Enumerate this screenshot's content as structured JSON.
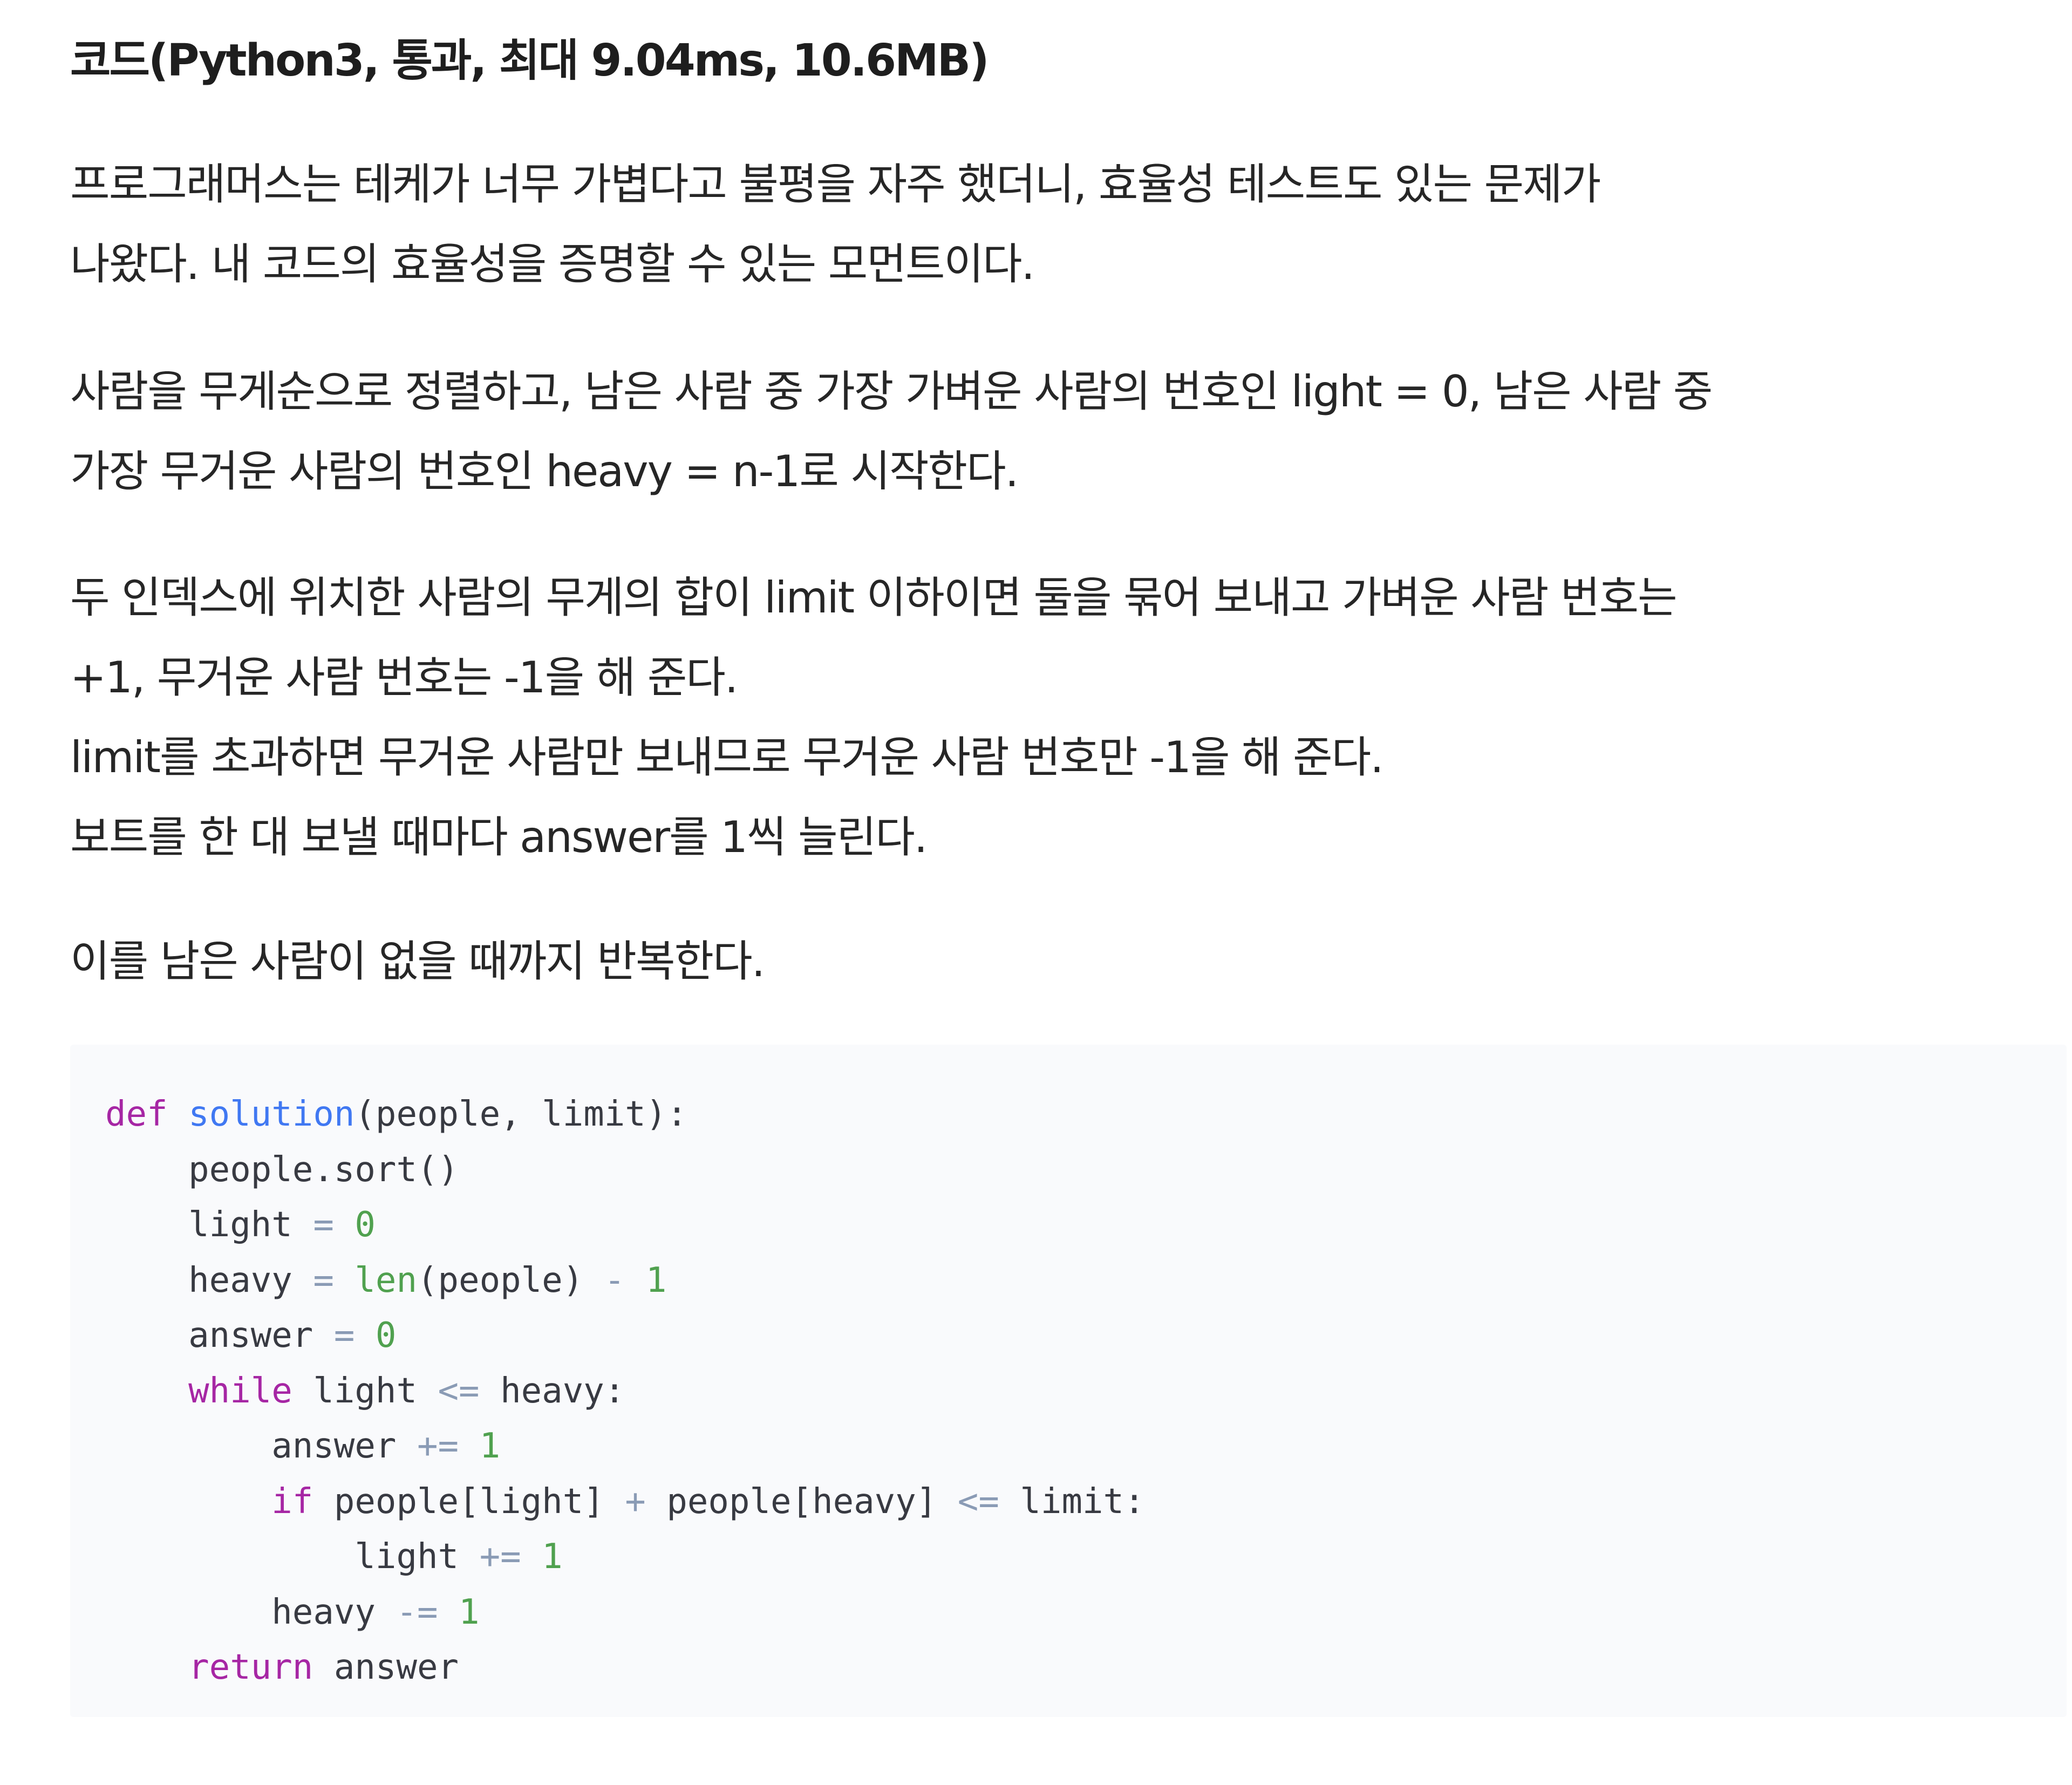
{
  "heading": "코드(Python3, 통과, 최대 9.04ms, 10.6MB)",
  "paragraphs": [
    {
      "lines": [
        "프로그래머스는 테케가 너무 가볍다고 불평을 자주 했더니, 효율성 테스트도 있는 문제가",
        "나왔다. 내 코드의 효율성을 증명할 수 있는 모먼트이다."
      ]
    },
    {
      "lines": [
        "사람을 무게순으로 정렬하고, 남은 사람 중 가장 가벼운 사람의 번호인 light = 0, 남은 사람 중",
        "가장 무거운 사람의 번호인 heavy = n-1로 시작한다."
      ]
    },
    {
      "lines": [
        "두 인덱스에 위치한 사람의 무게의 합이 limit 이하이면 둘을 묶어 보내고 가벼운 사람 번호는",
        "+1, 무거운 사람 번호는 -1을 해 준다.",
        "limit를 초과하면 무거운 사람만 보내므로 무거운 사람 번호만 -1을 해 준다.",
        "보트를 한 대 보낼 때마다 answer를 1씩 늘린다."
      ]
    },
    {
      "lines": [
        "이를 남은 사람이 없을 때까지 반복한다."
      ]
    }
  ],
  "code": {
    "language": "python",
    "lines": [
      [
        {
          "t": "kw",
          "v": "def"
        },
        {
          "t": "plain",
          "v": " "
        },
        {
          "t": "fn",
          "v": "solution"
        },
        {
          "t": "plain",
          "v": "(people, limit):"
        }
      ],
      [
        {
          "t": "plain",
          "v": "    people.sort()"
        }
      ],
      [
        {
          "t": "plain",
          "v": "    light "
        },
        {
          "t": "op",
          "v": "="
        },
        {
          "t": "plain",
          "v": " "
        },
        {
          "t": "num",
          "v": "0"
        }
      ],
      [
        {
          "t": "plain",
          "v": "    heavy "
        },
        {
          "t": "op",
          "v": "="
        },
        {
          "t": "plain",
          "v": " "
        },
        {
          "t": "builtin",
          "v": "len"
        },
        {
          "t": "plain",
          "v": "(people) "
        },
        {
          "t": "op",
          "v": "-"
        },
        {
          "t": "plain",
          "v": " "
        },
        {
          "t": "num",
          "v": "1"
        }
      ],
      [
        {
          "t": "plain",
          "v": "    answer "
        },
        {
          "t": "op",
          "v": "="
        },
        {
          "t": "plain",
          "v": " "
        },
        {
          "t": "num",
          "v": "0"
        }
      ],
      [
        {
          "t": "plain",
          "v": "    "
        },
        {
          "t": "kw",
          "v": "while"
        },
        {
          "t": "plain",
          "v": " light "
        },
        {
          "t": "op",
          "v": "<="
        },
        {
          "t": "plain",
          "v": " heavy:"
        }
      ],
      [
        {
          "t": "plain",
          "v": "        answer "
        },
        {
          "t": "op",
          "v": "+="
        },
        {
          "t": "plain",
          "v": " "
        },
        {
          "t": "num",
          "v": "1"
        }
      ],
      [
        {
          "t": "plain",
          "v": "        "
        },
        {
          "t": "kw",
          "v": "if"
        },
        {
          "t": "plain",
          "v": " people[light] "
        },
        {
          "t": "op",
          "v": "+"
        },
        {
          "t": "plain",
          "v": " people[heavy] "
        },
        {
          "t": "op",
          "v": "<="
        },
        {
          "t": "plain",
          "v": " limit:"
        }
      ],
      [
        {
          "t": "plain",
          "v": "            light "
        },
        {
          "t": "op",
          "v": "+="
        },
        {
          "t": "plain",
          "v": " "
        },
        {
          "t": "num",
          "v": "1"
        }
      ],
      [
        {
          "t": "plain",
          "v": "        heavy "
        },
        {
          "t": "op",
          "v": "-="
        },
        {
          "t": "plain",
          "v": " "
        },
        {
          "t": "num",
          "v": "1"
        }
      ],
      [
        {
          "t": "plain",
          "v": "    "
        },
        {
          "t": "kw",
          "v": "return"
        },
        {
          "t": "plain",
          "v": " answer"
        }
      ]
    ]
  },
  "colors": {
    "keyword": "#a626a4",
    "function": "#4078f2",
    "number": "#50a14f",
    "operator": "#8a9bb5",
    "code_background": "#f9fafc",
    "text": "#262626"
  }
}
